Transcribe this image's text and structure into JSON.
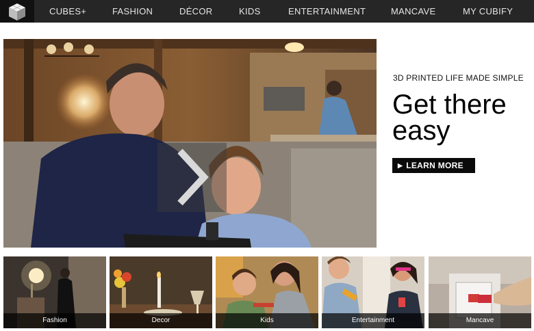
{
  "nav": {
    "items": [
      {
        "label": "CUBES+"
      },
      {
        "label": "FASHION"
      },
      {
        "label": "DÉCOR"
      },
      {
        "label": "KIDS"
      },
      {
        "label": "ENTERTAINMENT"
      },
      {
        "label": "MANCAVE"
      },
      {
        "label": "MY CUBIFY"
      }
    ]
  },
  "hero": {
    "next_icon": "chevron-right-icon"
  },
  "promo": {
    "eyebrow": "3D PRINTED LIFE MADE SIMPLE",
    "headline": "Get there easy",
    "cta_label": "LEARN MORE"
  },
  "thumbnails": [
    {
      "caption": "Fashion"
    },
    {
      "caption": "Decor"
    },
    {
      "caption": "Kids"
    },
    {
      "caption": "Entertainment"
    },
    {
      "caption": "Mancave"
    }
  ],
  "colors": {
    "nav_background": "#262626",
    "cta_background": "#0a0a0a",
    "page_background": "#ffffff"
  }
}
